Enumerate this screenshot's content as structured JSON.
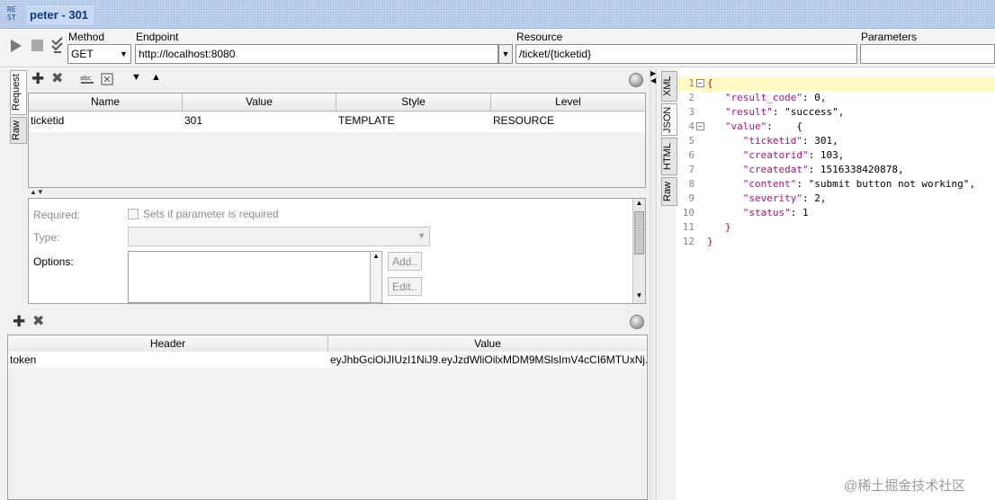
{
  "window": {
    "logo_text": "RE\nST",
    "title": "peter - 301"
  },
  "toolbar": {
    "method_label": "Method",
    "method_value": "GET",
    "endpoint_label": "Endpoint",
    "endpoint_value": "http://localhost:8080",
    "resource_label": "Resource",
    "resource_value": "/ticket/{ticketid}",
    "parameters_label": "Parameters"
  },
  "request_tabs": [
    "Request",
    "Raw"
  ],
  "params_table": {
    "columns": [
      "Name",
      "Value",
      "Style",
      "Level"
    ],
    "rows": [
      {
        "name": "ticketid",
        "value": "301",
        "style": "TEMPLATE",
        "level": "RESOURCE"
      }
    ]
  },
  "param_details": {
    "required_label": "Required:",
    "required_checkbox_label": "Sets if parameter is required",
    "type_label": "Type:",
    "options_label": "Options:",
    "add_button": "Add..",
    "edit_button": "Edit.."
  },
  "headers_table": {
    "columns": [
      "Header",
      "Value"
    ],
    "rows": [
      {
        "header": "token",
        "value": "eyJhbGciOiJIUzI1NiJ9.eyJzdWliOilxMDM9MSlsImV4cCI6MTUxNj..."
      }
    ]
  },
  "response_tabs": [
    "XML",
    "JSON",
    "HTML",
    "Raw"
  ],
  "response_lines": [
    {
      "num": "1",
      "fold": "−",
      "text": "{"
    },
    {
      "num": "2",
      "fold": "",
      "text": "   \"result_code\": 0,"
    },
    {
      "num": "3",
      "fold": "",
      "text": "   \"result\": \"success\","
    },
    {
      "num": "4",
      "fold": "−",
      "text": "   \"value\":    {"
    },
    {
      "num": "5",
      "fold": "",
      "text": "      \"ticketid\": 301,"
    },
    {
      "num": "6",
      "fold": "",
      "text": "      \"creatorid\": 103,"
    },
    {
      "num": "7",
      "fold": "",
      "text": "      \"createdat\": 1516338420878,"
    },
    {
      "num": "8",
      "fold": "",
      "text": "      \"content\": \"submit button not working\","
    },
    {
      "num": "9",
      "fold": "",
      "text": "      \"severity\": 2,"
    },
    {
      "num": "10",
      "fold": "",
      "text": "      \"status\": 1"
    },
    {
      "num": "11",
      "fold": "",
      "text": "   }"
    },
    {
      "num": "12",
      "fold": "",
      "text": "}"
    }
  ],
  "watermark": "@稀土掘金技术社区",
  "colors": {
    "title_bg": "#c7d9f1",
    "title_text": "#0d3a7a",
    "json_key": "#a0197a",
    "highlight_line": "#fff9c4"
  }
}
